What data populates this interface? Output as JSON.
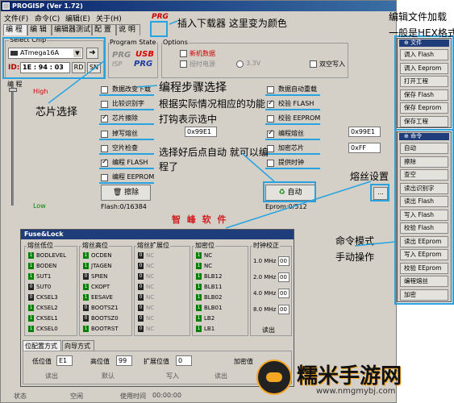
{
  "window": {
    "title": "PROGISP (Ver 1.72)"
  },
  "menu": [
    "文件(F)",
    "命令(C)",
    "编辑(E)",
    "关于(H)"
  ],
  "tabs": [
    "编 程",
    "编 辑",
    "编辑器测试",
    "配 置",
    "说 明"
  ],
  "chip": {
    "group_label": "Select Chip",
    "name": "ATmega16A",
    "id_label": "ID:",
    "id_value": "1E : 94 : 03",
    "rd": "RD",
    "sn": "SN"
  },
  "program_state": {
    "label": "Program State",
    "prg_label": "PRG",
    "isp_label": "ISP",
    "usb_label": "USB"
  },
  "options": {
    "label": "Options",
    "items": [
      "新机数据",
      "授时电源",
      "3.3V",
      "双空写入"
    ]
  },
  "slider": {
    "label": "编 程",
    "high": "High",
    "low": "Low"
  },
  "steps_col1": [
    "数据改变下载",
    "比较识别字",
    "芯片擦除",
    "掉写熔丝",
    "空片检查",
    "编程 FLASH",
    "编程 EEPROM"
  ],
  "steps_col2": [
    "数据自动重载",
    "校验 FLASH",
    "校验 EEPROM",
    "编程熔丝",
    "加密芯片",
    "提供时钟"
  ],
  "steps_col1_checked": [
    false,
    false,
    true,
    false,
    false,
    true,
    false
  ],
  "steps_col2_checked": [
    false,
    true,
    false,
    true,
    false,
    false
  ],
  "fields": {
    "hex1": "0x99E1",
    "hex2": "0x99E1",
    "hex3": "0xFF"
  },
  "buttons": {
    "erase": "擦除",
    "auto": "自动",
    "ellipsis": "..."
  },
  "counters": {
    "flash": "Flash:0/16384",
    "eprom": "Eprom:0/512"
  },
  "brand": "智 峰 软 件",
  "fuse": {
    "title": "Fuse&Lock",
    "col_headers": [
      "熔丝低位",
      "熔丝高位",
      "熔丝扩展位",
      "加密位",
      "时钟校正"
    ],
    "low": [
      {
        "state": "1",
        "name": "BODLEVEL"
      },
      {
        "state": "1",
        "name": "BODEN"
      },
      {
        "state": "1",
        "name": "SUT1"
      },
      {
        "state": "0",
        "name": "SUT0"
      },
      {
        "state": "0",
        "name": "CKSEL3"
      },
      {
        "state": "1",
        "name": "CKSEL2"
      },
      {
        "state": "1",
        "name": "CKSEL1"
      },
      {
        "state": "1",
        "name": "CKSEL0"
      }
    ],
    "high": [
      {
        "state": "1",
        "name": "OCDEN"
      },
      {
        "state": "1",
        "name": "JTAGEN"
      },
      {
        "state": "0",
        "name": "SPIEN"
      },
      {
        "state": "1",
        "name": "CKOPT"
      },
      {
        "state": "1",
        "name": "EESAVE"
      },
      {
        "state": "0",
        "name": "BOOTSZ1"
      },
      {
        "state": "0",
        "name": "BOOTSZ0"
      },
      {
        "state": "1",
        "name": "BOOTRST"
      }
    ],
    "ext": [
      {
        "state": "0",
        "name": "NC"
      },
      {
        "state": "0",
        "name": "NC"
      },
      {
        "state": "0",
        "name": "NC"
      },
      {
        "state": "0",
        "name": "NC"
      },
      {
        "state": "0",
        "name": "NC"
      },
      {
        "state": "0",
        "name": "NC"
      },
      {
        "state": "0",
        "name": "NC"
      },
      {
        "state": "0",
        "name": "NC"
      }
    ],
    "lock": [
      {
        "state": "1",
        "name": "NC"
      },
      {
        "state": "1",
        "name": "NC"
      },
      {
        "state": "1",
        "name": "BLB12"
      },
      {
        "state": "1",
        "name": "BLB11"
      },
      {
        "state": "1",
        "name": "BLB02"
      },
      {
        "state": "1",
        "name": "BLB01"
      },
      {
        "state": "1",
        "name": "LB2"
      },
      {
        "state": "1",
        "name": "LB1"
      }
    ],
    "clock": [
      {
        "freq": "1.0 MHz",
        "val": "00"
      },
      {
        "freq": "2.0 MHz",
        "val": "00"
      },
      {
        "freq": "4.0 MHz",
        "val": "00"
      },
      {
        "freq": "8.0 MHz",
        "val": "00"
      }
    ],
    "clock_read": "读出",
    "subtabs": [
      "位配置方式",
      "向导方式"
    ],
    "low_label": "低位值",
    "low_val": "E1",
    "high_label": "高位值",
    "high_val": "99",
    "ext_label": "扩展位值",
    "ext_val": "0",
    "lock_label": "加密值",
    "bottom_buttons": [
      "读出",
      "默认",
      "写入",
      "读出"
    ]
  },
  "file_panel": {
    "header": "文件",
    "items": [
      "调入 Flash",
      "调入 Eeprom",
      "打开工程",
      "保存 Flash",
      "保存 Eeprom",
      "保存工程"
    ]
  },
  "cmd_panel": {
    "header": "命令",
    "items": [
      "自动",
      "擦除",
      "查空",
      "读出识别字",
      "读出 Flash",
      "写入 Flash",
      "校验 Flash",
      "读出 EEprom",
      "写入 EEprom",
      "校验 EEprom",
      "编程熔丝",
      "加密"
    ]
  },
  "status": [
    "状态",
    "空闲",
    "使用时间",
    "00:00:00"
  ],
  "annotations": {
    "downloader": "插入下载器 这里变为颜色",
    "edit_file": "编辑文件加载",
    "hex_format": "一般是HEX格式",
    "chip_select": "芯片选择",
    "program_steps": "编程步骤选择",
    "select_hint1": "根据实际情况相应的功能",
    "select_hint2": "打钩表示选中",
    "auto_hint1": "选择好后点自动 就可以编",
    "auto_hint2": "程了",
    "fuse_setting": "熔丝设置",
    "cmd_mode1": "命令模式",
    "cmd_mode2": "手动操作",
    "watermark_title": "糯米手游网",
    "watermark_url": "www.nmgmybj.com"
  }
}
